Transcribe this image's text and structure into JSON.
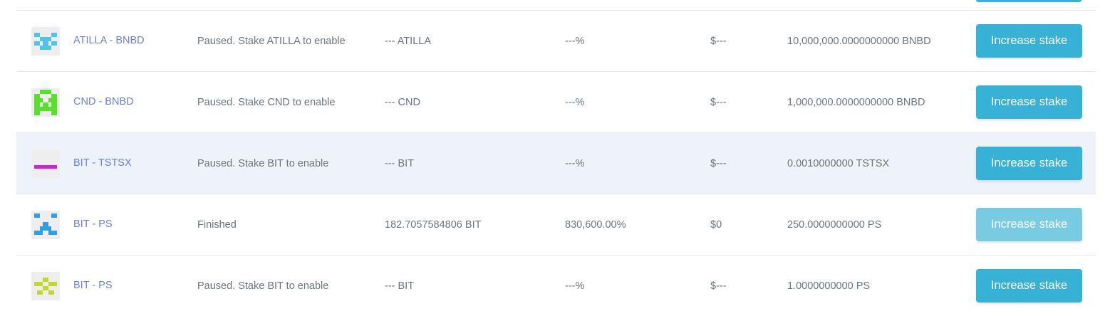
{
  "accent_color": "#37b2d6",
  "rows": [
    {
      "icon": "atilla-token-icon",
      "icon_color": "#4fc3e8",
      "pair": "ATILLA - BNBD",
      "status": "Paused. Stake ATILLA to enable",
      "earned": "--- ATILLA",
      "apr": "---%",
      "usd": "$---",
      "total": "10,000,000.0000000000 BNBD",
      "action": "Increase stake",
      "action_enabled": true
    },
    {
      "icon": "cnd-token-icon",
      "icon_color": "#5ae02a",
      "pair": "CND - BNBD",
      "status": "Paused. Stake CND to enable",
      "earned": "--- CND",
      "apr": "---%",
      "usd": "$---",
      "total": "1,000,000.0000000000 BNBD",
      "action": "Increase stake",
      "action_enabled": true
    },
    {
      "icon": "bit-token-icon",
      "icon_color": "#d61fd6",
      "pair": "BIT - TSTSX",
      "status": "Paused. Stake BIT to enable",
      "earned": "--- BIT",
      "apr": "---%",
      "usd": "$---",
      "total": "0.0010000000 TSTSX",
      "action": "Increase stake",
      "action_enabled": true
    },
    {
      "icon": "bit-token-icon",
      "icon_color": "#2f9fe0",
      "pair": "BIT - PS",
      "status": "Finished",
      "earned": "182.7057584806 BIT",
      "apr": "830,600.00%",
      "usd": "$0",
      "total": "250.0000000000 PS",
      "action": "Increase stake",
      "action_enabled": false
    },
    {
      "icon": "bit-token-icon",
      "icon_color": "#c3d62a",
      "pair": "BIT - PS",
      "status": "Paused. Stake BIT to enable",
      "earned": "--- BIT",
      "apr": "---%",
      "usd": "$---",
      "total": "1.0000000000 PS",
      "action": "Increase stake",
      "action_enabled": true
    }
  ]
}
